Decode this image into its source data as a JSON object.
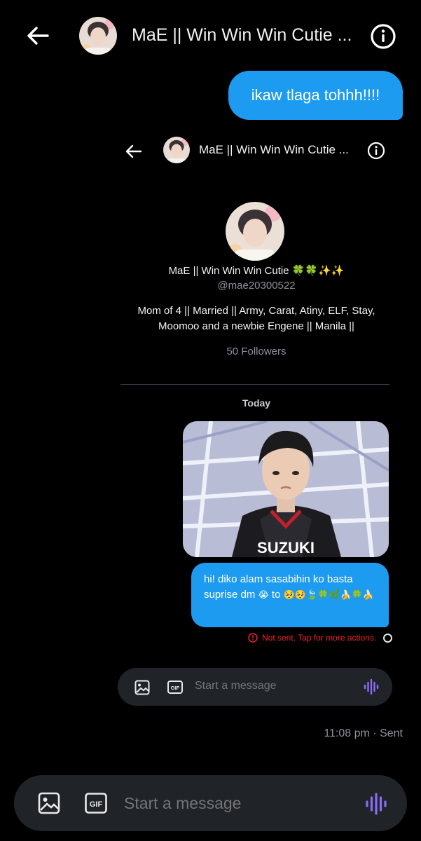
{
  "header": {
    "title": "MaE || Win Win Win Cutie ...",
    "back_icon": "arrow-left-icon",
    "info_icon": "info-icon"
  },
  "messages": {
    "top_sent": "ikaw tlaga tohhh!!!!"
  },
  "embedded": {
    "header_title": "MaE || Win Win Win Cutie ...",
    "profile": {
      "name": "MaE || Win Win Win Cutie 🍀🍀✨✨",
      "handle": "@mae20300522",
      "bio": "Mom of 4 || Married || Army, Carat, Atiny, ELF, Stay, Moomoo and a newbie Engene || Manila ||",
      "followers": "50 Followers"
    },
    "date_separator": "Today",
    "photo_text": "SUZUKI",
    "message_text": "hi! diko alam sasabihin ko basta suprise dm",
    "message_emoji_1": "😭",
    "message_mid": "to",
    "message_emoji_2": "🥺🥺🍃🍀🌿🍌🍀🍌",
    "status_text": "Not sent. Tap for more actions.",
    "composer_placeholder": "Start a message"
  },
  "timestamp": "11:08 pm · Sent",
  "composer": {
    "placeholder": "Start a message",
    "icons": [
      "image-icon",
      "gif-icon",
      "voice-icon"
    ]
  },
  "colors": {
    "accent_blue": "#1d9bf0",
    "background": "#000000",
    "composer_bg": "#202327",
    "error_red": "#f4212e",
    "voice_purple": "#8b6cf5"
  }
}
